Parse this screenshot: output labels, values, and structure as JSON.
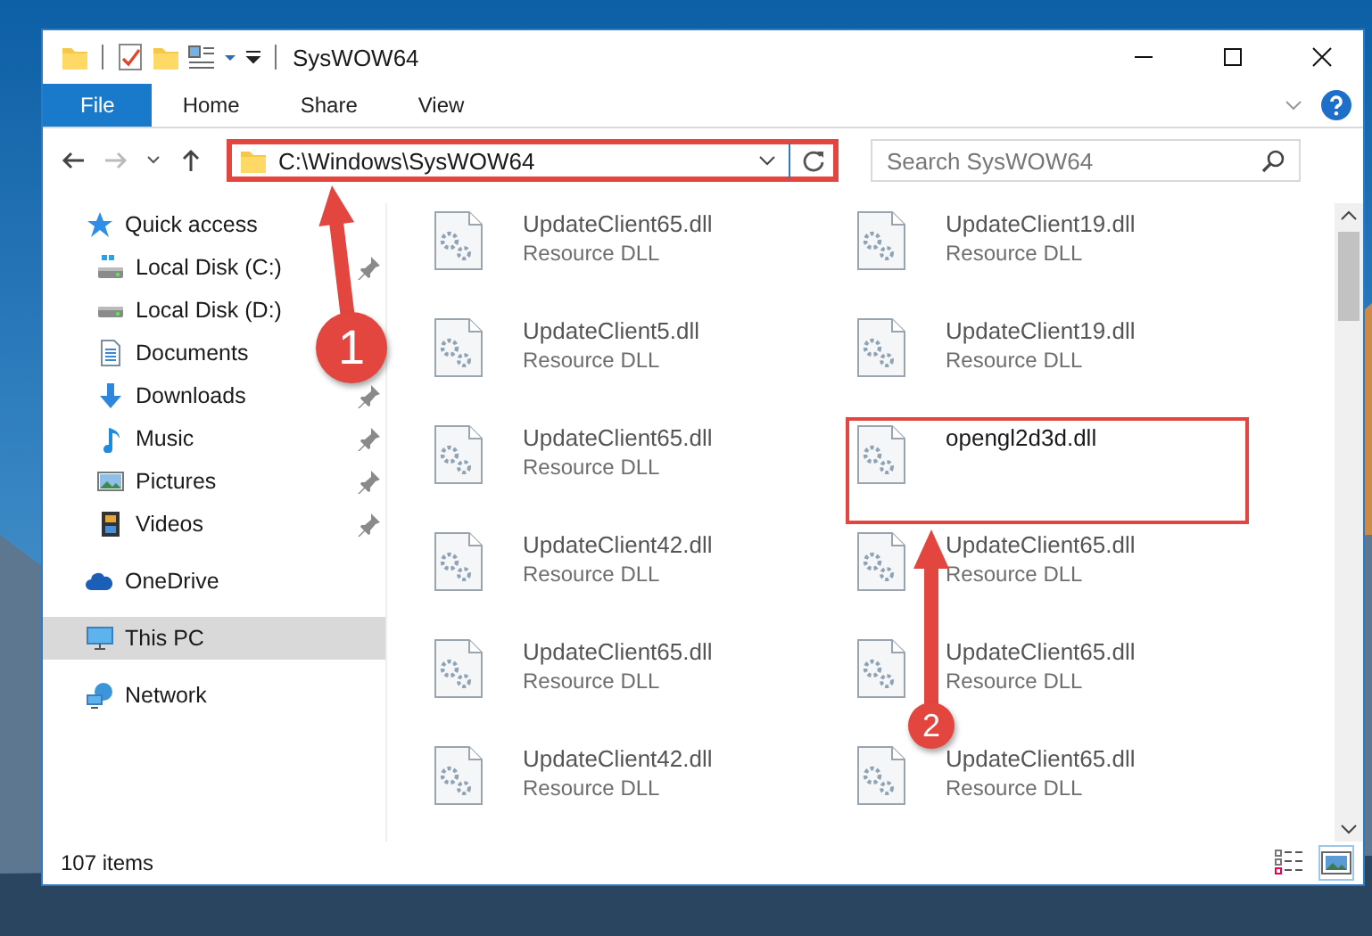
{
  "window": {
    "title": "SysWOW64"
  },
  "ribbon_tabs": [
    {
      "label": "File",
      "selected": true
    },
    {
      "label": "Home",
      "selected": false
    },
    {
      "label": "Share",
      "selected": false
    },
    {
      "label": "View",
      "selected": false
    }
  ],
  "address_bar": {
    "value": "C:\\Windows\\SysWOW64",
    "highlighted": true
  },
  "search": {
    "placeholder": "Search SysWOW64"
  },
  "sidebar": {
    "items": [
      {
        "label": "Quick access",
        "kind": "star",
        "selected": false,
        "children": [
          {
            "label": "Local Disk (C:)",
            "kind": "system-drive",
            "pinned": true
          },
          {
            "label": "Local Disk (D:)",
            "kind": "drive"
          },
          {
            "label": "Documents",
            "kind": "documents"
          },
          {
            "label": "Downloads",
            "kind": "downloads",
            "pinned": true
          },
          {
            "label": "Music",
            "kind": "music",
            "pinned": true
          },
          {
            "label": "Pictures",
            "kind": "pictures",
            "pinned": true
          },
          {
            "label": "Videos",
            "kind": "videos",
            "pinned": true
          }
        ]
      },
      {
        "label": "OneDrive",
        "kind": "cloud",
        "selected": false
      },
      {
        "label": "This PC",
        "kind": "pc",
        "selected": true
      },
      {
        "label": "Network",
        "kind": "network",
        "selected": false
      }
    ]
  },
  "files": [
    {
      "name": "UpdateClient65.dll",
      "type": "Resource DLL",
      "blurred": true,
      "highlighted": false
    },
    {
      "name": "UpdateClient19.dll",
      "type": "Resource DLL",
      "blurred": true,
      "highlighted": false
    },
    {
      "name": "UpdateClient5.dll",
      "type": "Resource DLL",
      "blurred": true,
      "highlighted": false
    },
    {
      "name": "UpdateClient19.dll",
      "type": "Resource DLL",
      "blurred": true,
      "highlighted": false
    },
    {
      "name": "UpdateClient65.dll",
      "type": "Resource DLL",
      "blurred": true,
      "highlighted": false
    },
    {
      "name": "opengl2d3d.dll",
      "blurred": false,
      "highlighted": true
    },
    {
      "name": "UpdateClient42.dll",
      "type": "Resource DLL",
      "blurred": true,
      "highlighted": false
    },
    {
      "name": "UpdateClient65.dll",
      "type": "Resource DLL",
      "blurred": true,
      "highlighted": false
    },
    {
      "name": "UpdateClient65.dll",
      "type": "Resource DLL",
      "blurred": true,
      "highlighted": false
    },
    {
      "name": "UpdateClient65.dll",
      "type": "Resource DLL",
      "blurred": true,
      "highlighted": false
    },
    {
      "name": "UpdateClient42.dll",
      "type": "Resource DLL",
      "blurred": true,
      "highlighted": false
    },
    {
      "name": "UpdateClient65.dll",
      "type": "Resource DLL",
      "blurred": true,
      "highlighted": false
    }
  ],
  "status_bar": {
    "text": "107 items",
    "views": [
      {
        "kind": "details",
        "selected": false
      },
      {
        "kind": "large-icons",
        "selected": true
      }
    ]
  },
  "annotations": [
    {
      "label": "1"
    },
    {
      "label": "2"
    }
  ]
}
